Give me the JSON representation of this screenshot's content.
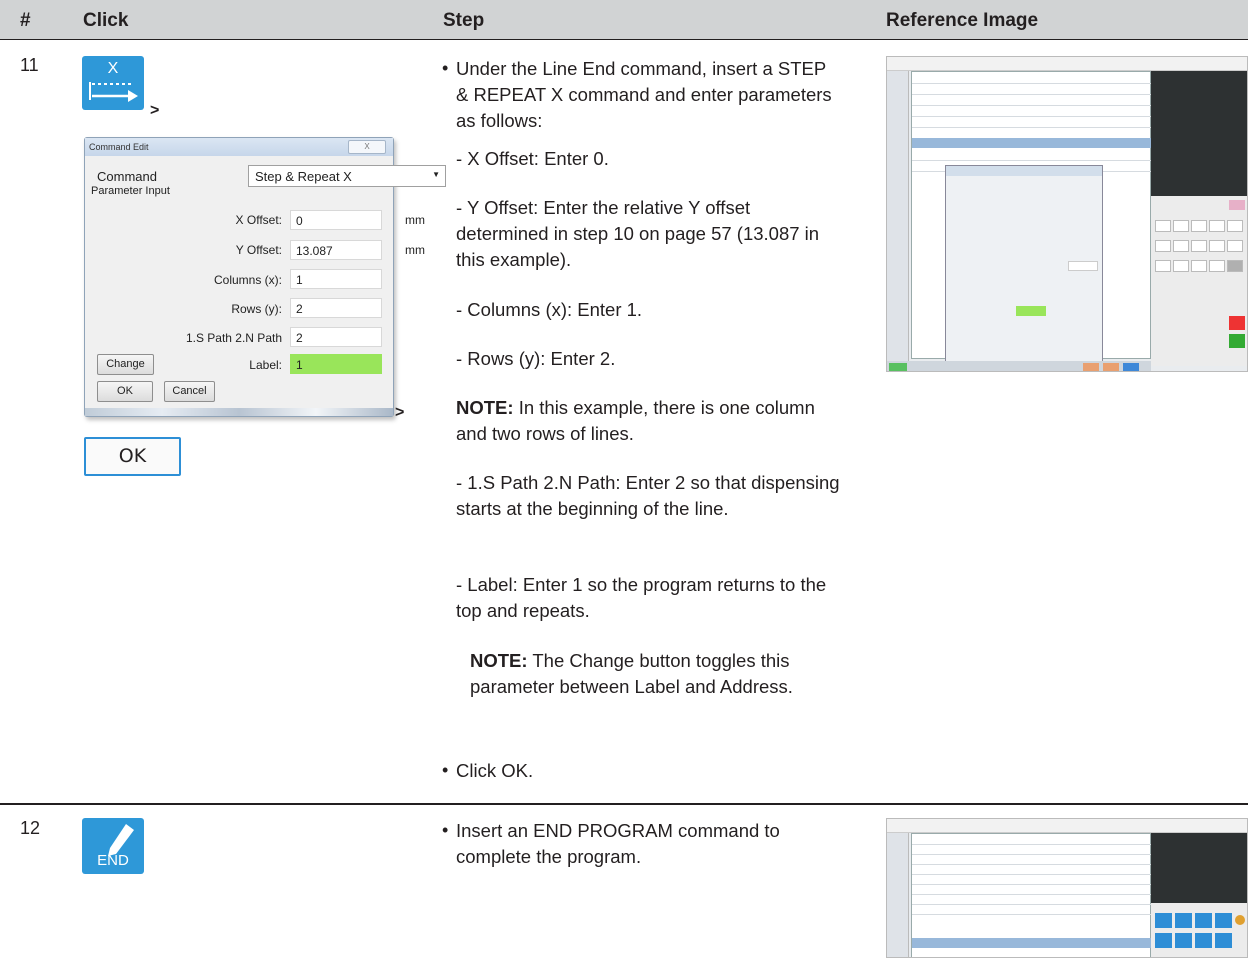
{
  "header": {
    "num": "#",
    "click": "Click",
    "step": "Step",
    "ref": "Reference Image"
  },
  "row11": {
    "num": "11",
    "icon": {
      "name": "step-repeat-x-icon",
      "letter": "X"
    },
    "gt1": ">",
    "gt2": ">",
    "dialog": {
      "title": "Command Edit",
      "close": "X",
      "command_label": "Command",
      "command_value": "Step & Repeat X",
      "param_label": "Parameter Input",
      "fields": [
        {
          "label": "X Offset:",
          "value": "0",
          "unit": "mm"
        },
        {
          "label": "Y Offset:",
          "value": "13.087",
          "unit": "mm"
        },
        {
          "label": "Columns (x):",
          "value": "1",
          "unit": ""
        },
        {
          "label": "Rows (y):",
          "value": "2",
          "unit": ""
        },
        {
          "label": "1.S Path 2.N Path",
          "value": "2",
          "unit": ""
        }
      ],
      "label_label": "Label:",
      "label_value": "1",
      "change_btn": "Change",
      "ok_btn": "OK",
      "cancel_btn": "Cancel",
      "label_color": "#99e55a"
    },
    "ok_button": "OK",
    "steps": {
      "b1": "Under the Line End command, insert a STEP & REPEAT X command and enter parameters as follows:",
      "d1": "- X Offset: Enter 0.",
      "d2": "- Y Offset: Enter the relative Y offset determined in step 10 on page 57 (13.087 in this example).",
      "d3": "- Columns (x): Enter 1.",
      "d4": "- Rows (y): Enter 2.",
      "note1_label": "NOTE:",
      "note1_text": "In this example, there is one column and two rows of lines.",
      "d5": "- 1.S Path 2.N Path: Enter 2 so that dispensing starts at the beginning of the line.",
      "d6": "- Label: Enter 1 so the program returns to the top and repeats.",
      "note2_label": "NOTE:",
      "note2_text": "The Change button toggles this parameter between Label and Address.",
      "b2": "Click OK."
    }
  },
  "row12": {
    "num": "12",
    "icon": {
      "name": "end-program-icon",
      "text": "END"
    },
    "steps": {
      "b1": "Insert an END PROGRAM command to complete the program."
    }
  },
  "colors": {
    "icon_blue": "#2e98d8",
    "header_gray": "#d1d3d4",
    "ok_border": "#2d8fd6"
  }
}
